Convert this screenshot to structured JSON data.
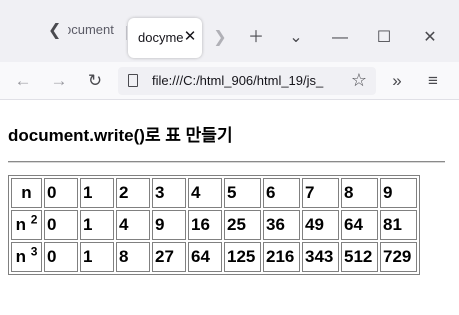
{
  "browser": {
    "tabs": [
      {
        "label": "ocument",
        "active": false
      },
      {
        "label": "docyme",
        "active": true
      }
    ],
    "url": "file:///C:/html_906/html_19/js_",
    "icons": {
      "tab_scroll": "chevron-left-icon",
      "new_tab": "plus-icon",
      "list_tabs": "chevron-down-icon",
      "minimize": "minimize-icon",
      "maximize": "maximize-icon",
      "close": "close-icon"
    }
  },
  "page": {
    "heading": "document.write()로 표 만들기",
    "table": {
      "rows": [
        {
          "label": "n",
          "sup": "",
          "values": [
            "0",
            "1",
            "2",
            "3",
            "4",
            "5",
            "6",
            "7",
            "8",
            "9"
          ]
        },
        {
          "label": "n",
          "sup": "2",
          "values": [
            "0",
            "1",
            "4",
            "9",
            "16",
            "25",
            "36",
            "49",
            "64",
            "81"
          ]
        },
        {
          "label": "n",
          "sup": "3",
          "values": [
            "0",
            "1",
            "8",
            "27",
            "64",
            "125",
            "216",
            "343",
            "512",
            "729"
          ]
        }
      ]
    }
  }
}
